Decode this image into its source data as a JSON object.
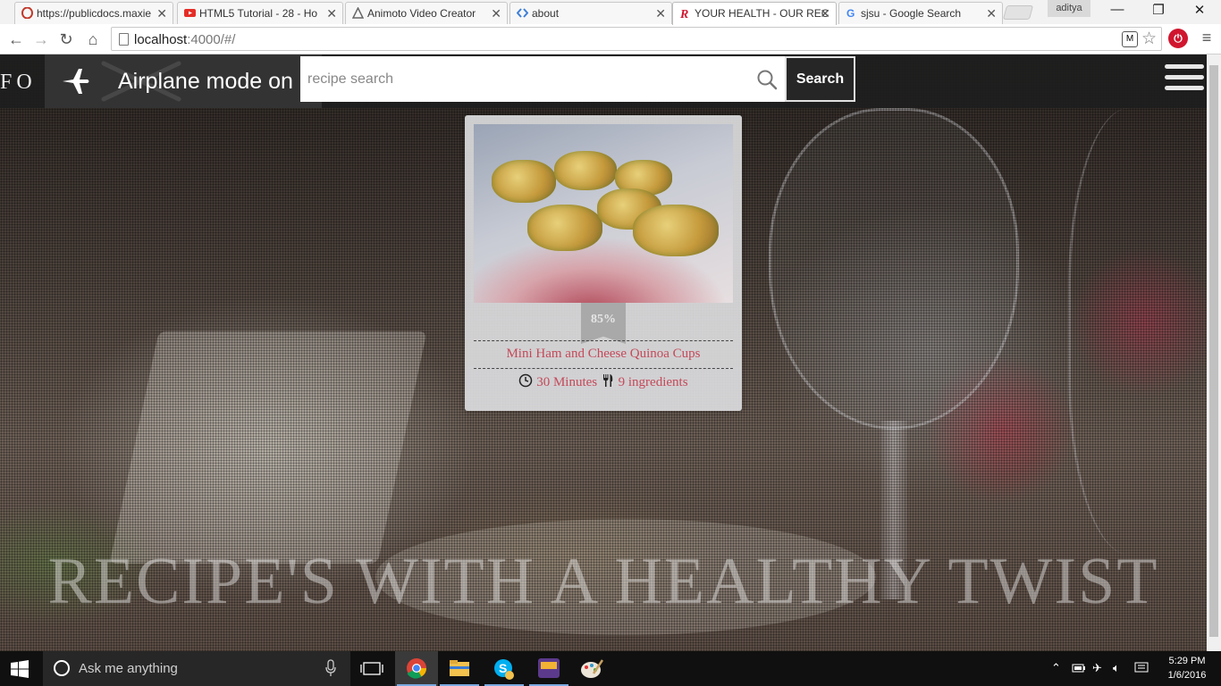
{
  "browser": {
    "tabs": [
      {
        "title": "https://publicdocs.maxie",
        "icon": "opera-icon"
      },
      {
        "title": "HTML5 Tutorial - 28 - Ho",
        "icon": "youtube-icon"
      },
      {
        "title": "Animoto Video Creator",
        "icon": "animoto-icon"
      },
      {
        "title": "about",
        "icon": "code-icon"
      },
      {
        "title": "YOUR HEALTH - OUR REC",
        "icon": "r-logo-icon"
      },
      {
        "title": "sjsu - Google Search",
        "icon": "google-icon"
      }
    ],
    "active_tab_index": 4,
    "profile_name": "aditya",
    "url_host": "localhost",
    "url_rest": ":4000/#/",
    "extension_label": "M"
  },
  "site": {
    "logo_text": "FO",
    "airplane_mode_text": "Airplane mode on",
    "search": {
      "placeholder": "recipe search",
      "button_label": "Search"
    },
    "tagline": "RECIPE'S WITH A HEALTHY TWIST"
  },
  "recipe_card": {
    "match_percent": "85%",
    "title": "Mini Ham and Cheese Quinoa Cups",
    "time": "30 Minutes",
    "ingredients": "9 ingredients"
  },
  "taskbar": {
    "search_placeholder": "Ask me anything",
    "clock_time": "5:29 PM",
    "clock_date": "1/6/2016",
    "pinned": [
      "task-view-icon",
      "chrome-icon",
      "file-explorer-icon",
      "skype-icon",
      "game-icon",
      "paint-icon"
    ]
  },
  "colors": {
    "accent_text": "#c44a5a",
    "header_bg": "#1e1e1e",
    "search_button_bg": "#262626"
  }
}
